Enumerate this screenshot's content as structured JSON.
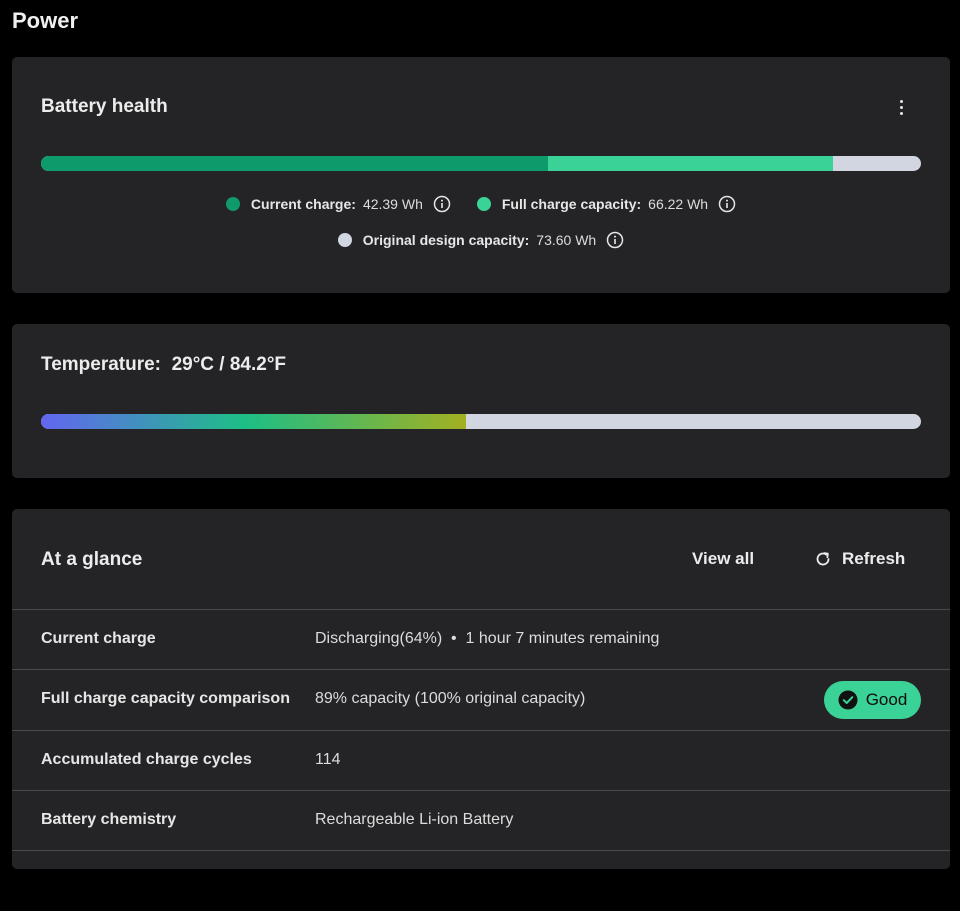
{
  "page": {
    "title": "Power"
  },
  "battery_health": {
    "title": "Battery health",
    "more_icon": "more-vertical-icon",
    "bar": {
      "current_fraction": 0.5759,
      "full_fraction": 0.8997,
      "colors": {
        "current": "#0e9a6b",
        "full": "#3ad296",
        "design": "#d1d6e0"
      }
    },
    "legend": {
      "current_charge": {
        "label": "Current charge:",
        "value": "42.39 Wh",
        "color": "#0e9a6b"
      },
      "full_charge": {
        "label": "Full charge capacity:",
        "value": "66.22 Wh",
        "color": "#3ad296"
      },
      "design_capacity": {
        "label": "Original design capacity:",
        "value": "73.60 Wh",
        "color": "#d1d6e0"
      }
    },
    "info_icon": "info-circle-icon"
  },
  "temperature": {
    "title": "Temperature:  29°C / 84.2°F",
    "fill_fraction": 0.483,
    "gradient_colors": [
      "#6366f1",
      "#1dbf86",
      "#a3b021"
    ],
    "track_color": "#d1d6e0"
  },
  "at_a_glance": {
    "title": "At a glance",
    "view_all_label": "View all",
    "refresh_label": "Refresh",
    "refresh_icon": "refresh-icon",
    "rows": [
      {
        "label": "Current charge",
        "value": "Discharging(64%)  •  1 hour 7 minutes remaining"
      },
      {
        "label": "Full charge capacity comparison",
        "value": "89% capacity (100% original capacity)",
        "badge": "Good"
      },
      {
        "label": "Accumulated charge cycles",
        "value": "114"
      },
      {
        "label": "Battery chemistry",
        "value": "Rechargeable Li-ion Battery"
      }
    ],
    "badge_color": "#3ad296"
  }
}
